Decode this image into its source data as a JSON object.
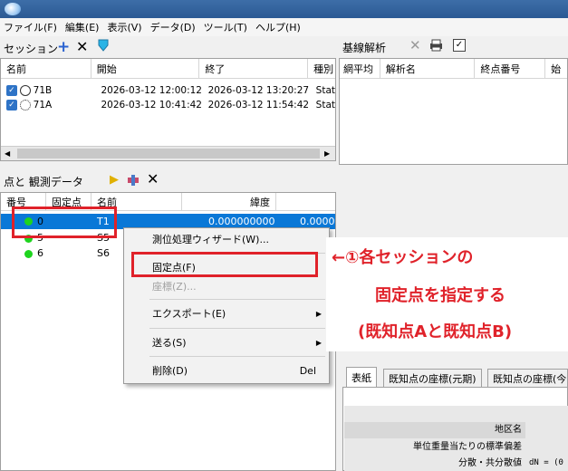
{
  "menubar": [
    "ファイル(F)",
    "編集(E)",
    "表示(V)",
    "データ(D)",
    "ツール(T)",
    "ヘルプ(H)"
  ],
  "session": {
    "title": "セッション",
    "columns": [
      "名前",
      "開始",
      "終了",
      "種別"
    ],
    "rows": [
      {
        "name": "71B",
        "start": "2026-03-12 12:00:12",
        "end": "2026-03-12 13:20:27",
        "type": "Stat"
      },
      {
        "name": "71A",
        "start": "2026-03-12 10:41:42",
        "end": "2026-03-12 11:54:42",
        "type": "Stat"
      }
    ]
  },
  "baseline": {
    "title": "基線解析",
    "columns": [
      "網平均",
      "解析名",
      "終点番号",
      "始"
    ]
  },
  "points": {
    "title": "点と 観測データ",
    "columns": [
      "番号",
      "固定点",
      "名前",
      "緯度"
    ],
    "rows": [
      {
        "num": "0",
        "name": "T1",
        "lat": "0.000000000",
        "lat2": "0.0000"
      },
      {
        "num": "5",
        "name": "S5",
        "lat": "",
        "lat2": ""
      },
      {
        "num": "6",
        "name": "S6",
        "lat": "",
        "lat2": ""
      }
    ]
  },
  "context_menu": {
    "wizard": "測位処理ウィザード(W)...",
    "fixed": "固定点(F)",
    "coords": "座標(Z)...",
    "export": "エクスポート(E)",
    "send": "送る(S)",
    "delete": "削除(D)",
    "delete_shortcut": "Del"
  },
  "annotation": {
    "line1": "←①各セッションの",
    "line2": "固定点を指定する",
    "line3": "(既知点Aと既知点B)"
  },
  "tabs": [
    "表紙",
    "既知点の座標(元期)",
    "既知点の座標(今"
  ],
  "report": {
    "rows": [
      "地区名",
      "単位重量当たりの標準偏差",
      "分散・共分散値"
    ],
    "value": "dN = (0"
  },
  "colors": {
    "accent": "#e0222a",
    "selection": "#0a78d7",
    "status_dot": "#1ed41e"
  }
}
